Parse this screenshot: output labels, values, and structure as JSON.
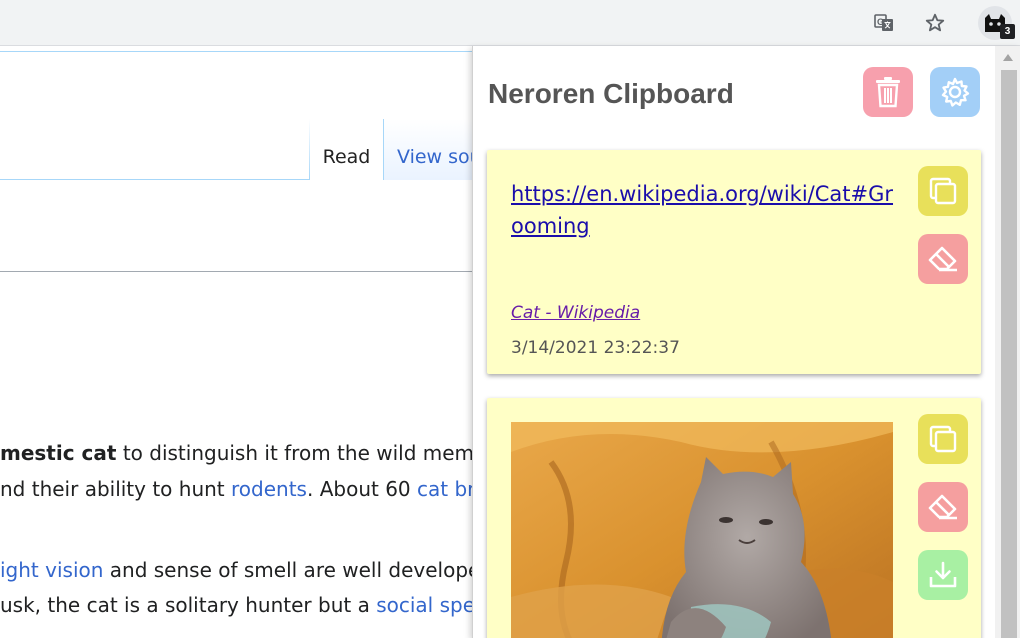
{
  "browser": {
    "extension_badge": "3"
  },
  "wiki": {
    "tabs": {
      "read": "Read",
      "view_source": "View source"
    },
    "paragraphs": [
      {
        "segments": [
          {
            "text": "mestic cat",
            "style": "bold"
          },
          {
            "text": " to distinguish it from the wild members"
          }
        ]
      },
      {
        "segments": [
          {
            "text": "nd their ability to hunt "
          },
          {
            "text": "rodents",
            "style": "link"
          },
          {
            "text": ". About 60 "
          },
          {
            "text": "cat breeds",
            "style": "link"
          }
        ]
      },
      {
        "segments": [
          {
            "text": "ight vision",
            "style": "link"
          },
          {
            "text": " and sense of smell are well developed"
          }
        ]
      },
      {
        "segments": [
          {
            "text": "usk, the cat is a solitary hunter but a "
          },
          {
            "text": "social species",
            "style": "link"
          }
        ]
      }
    ]
  },
  "popup": {
    "title": "Neroren Clipboard",
    "cards": [
      {
        "type": "link",
        "url": "https://en.wikipedia.org/wiki/Cat#Grooming",
        "source": "Cat - Wikipedia",
        "timestamp": "3/14/2021 23:22:37"
      },
      {
        "type": "image"
      }
    ]
  },
  "colors": {
    "trash_button": "#f7a0ad",
    "settings_button": "#a3cff7",
    "copy_button": "#e8e05a",
    "erase_button": "#f59f9f",
    "download_button": "#a8f0a3",
    "card_background": "#ffffc6"
  }
}
